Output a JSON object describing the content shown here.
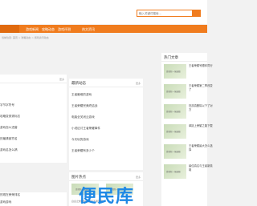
{
  "search": {
    "placeholder": "输入关键词搜索..."
  },
  "nav": {
    "items": [
      "游戏新闻",
      "攻略动态",
      "游戏评测",
      "热文资讯"
    ]
  },
  "breadcrumb": "当前位置: 首页 > 攻略动态 > 游戏资讯动态",
  "left_panel": {
    "more": "更多",
    "items": [
      "",
      "",
      "字节字符号",
      "攻略变秀秀标志",
      "游戏怎么进营",
      "的最清爽符名",
      "游戏名怎么搞"
    ]
  },
  "center_panel": {
    "title": "最新动态",
    "more": "更多",
    "items": [
      "王者最难的游戏",
      "王者荣耀完美终结战",
      "电脑全关闭云游戏",
      "小说征讨王者荣耀事件",
      "今天玩的游戏",
      "王者荣耀有多少个"
    ]
  },
  "center_panel2": {
    "title": "图片热点",
    "more": "更多",
    "footer": "白白之前网站是属于王者荣耀"
  },
  "hot_panel": {
    "title": "热门文章",
    "items": [
      "王者荣耀号跟你同行",
      "王者荣耀第二季改变了",
      "狂孩真删除以下了对方",
      "单挑上荣耀之路下载",
      "王者荣耀最大怎么选择",
      "最佳真名与王者新英雄"
    ]
  },
  "thumb_label": "游戏新一张展图",
  "left_panel2": {
    "items": [
      "的现在荣荣排名",
      "游戏游戏"
    ]
  },
  "watermark": "便民库"
}
